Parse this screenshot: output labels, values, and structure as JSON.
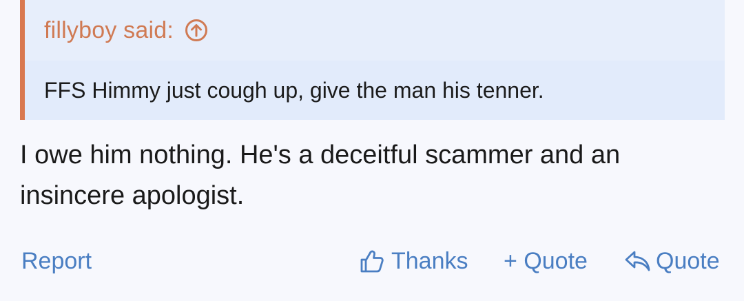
{
  "quote": {
    "author": "fillyboy said:",
    "jump_icon": "arrow-up-circle-icon",
    "text": "FFS Himmy just cough up, give the man his tenner."
  },
  "post": {
    "message": "I owe him nothing. He's a deceitful scammer and an insincere apologist."
  },
  "actions": {
    "report": "Report",
    "thanks": "Thanks",
    "thanks_icon": "thumbs-up-icon",
    "multi_quote": "+ Quote",
    "reply_quote": "Quote",
    "reply_icon": "reply-arrow-icon"
  },
  "colors": {
    "background": "#f7f8fd",
    "quote_background": "#e2ebfb",
    "quote_accent": "#d9784f",
    "link": "#4a7ec2",
    "text": "#1a1a1a"
  }
}
